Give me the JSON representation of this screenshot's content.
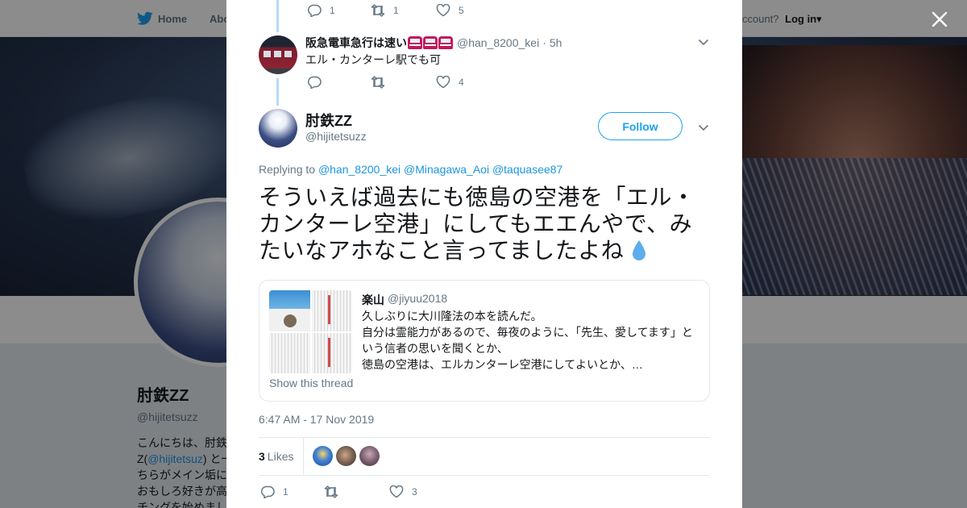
{
  "background": {
    "nav": {
      "home_label": "Home",
      "about_label": "Abo",
      "account_prompt": "ccount?",
      "login_label": "Log in"
    },
    "profile": {
      "name": "肘鉄ZZ",
      "handle": "@hijitetsuzz",
      "bio_lines": [
        "こんにちは、肘鉄",
        "Z(",
        "ちらがメイン垢に",
        "おもしろ好きが高",
        "チングを始めまし"
      ],
      "bio_link": "@hijitetsuz",
      "bio_after_link": ") と一"
    }
  },
  "colors": {
    "accent": "#1da1f2",
    "link": "#1b95e0",
    "muted": "#657786",
    "thread_line": "#b4dcf7"
  },
  "thread": {
    "prev_actions": {
      "replies": "1",
      "retweets": "1",
      "likes": "5"
    },
    "reply": {
      "name": "阪急電車急行は速い",
      "name_emoji": [
        "train-icon",
        "train-icon",
        "train-icon"
      ],
      "handle": "@han_8200_kei",
      "separator": "·",
      "time": "5h",
      "text": "エル・カンターレ駅でも可",
      "actions": {
        "replies": "",
        "retweets": "",
        "likes": "4"
      }
    }
  },
  "tweet": {
    "name": "肘鉄ZZ",
    "handle": "@hijitetsuzz",
    "follow_label": "Follow",
    "replying_label": "Replying to",
    "replying_to": [
      "@han_8200_kei",
      "@Minagawa_Aoi",
      "@taquasee87"
    ],
    "text": "そういえば過去にも徳島の空港を「エル・カンターレ空港」にしてもエエんやで、みたいなアホなこと言ってましたよね",
    "text_emoji": "droplet-icon",
    "timestamp": "6:47 AM - 17 Nov 2019",
    "likes_count": "3",
    "likes_label": "Likes",
    "actions": {
      "replies": "1",
      "retweets": "",
      "likes": "3"
    }
  },
  "quote": {
    "name": "楽山",
    "handle": "@jiyuu2018",
    "lines": [
      "久しぶりに大川隆法の本を読んだ。",
      "自分は霊能力があるので、毎夜のように、「先生、愛してます」と",
      "いう信者の思いを聞くとか、",
      "徳島の空港は、エルカンターレ空港にしてよいとか、…"
    ],
    "show_thread_label": "Show this thread"
  }
}
